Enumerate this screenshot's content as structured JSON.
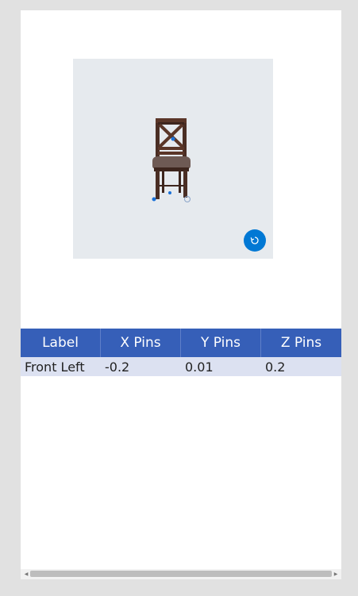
{
  "viewer": {
    "object_icon": "chair-3d-model",
    "reset_icon": "reset-view-icon",
    "accent_color": "#0078d4",
    "background_color": "#e6eaee"
  },
  "pins_table": {
    "header_color": "#365fb8",
    "row_color": "#dce1f1",
    "columns": [
      "Label",
      "X Pins",
      "Y Pins",
      "Z Pins"
    ],
    "rows": [
      [
        "Front Left",
        "-0.2",
        "0.01",
        "0.2"
      ]
    ]
  },
  "scrollbar": {
    "left_icon": "arrow-left-icon",
    "right_icon": "arrow-right-icon"
  }
}
